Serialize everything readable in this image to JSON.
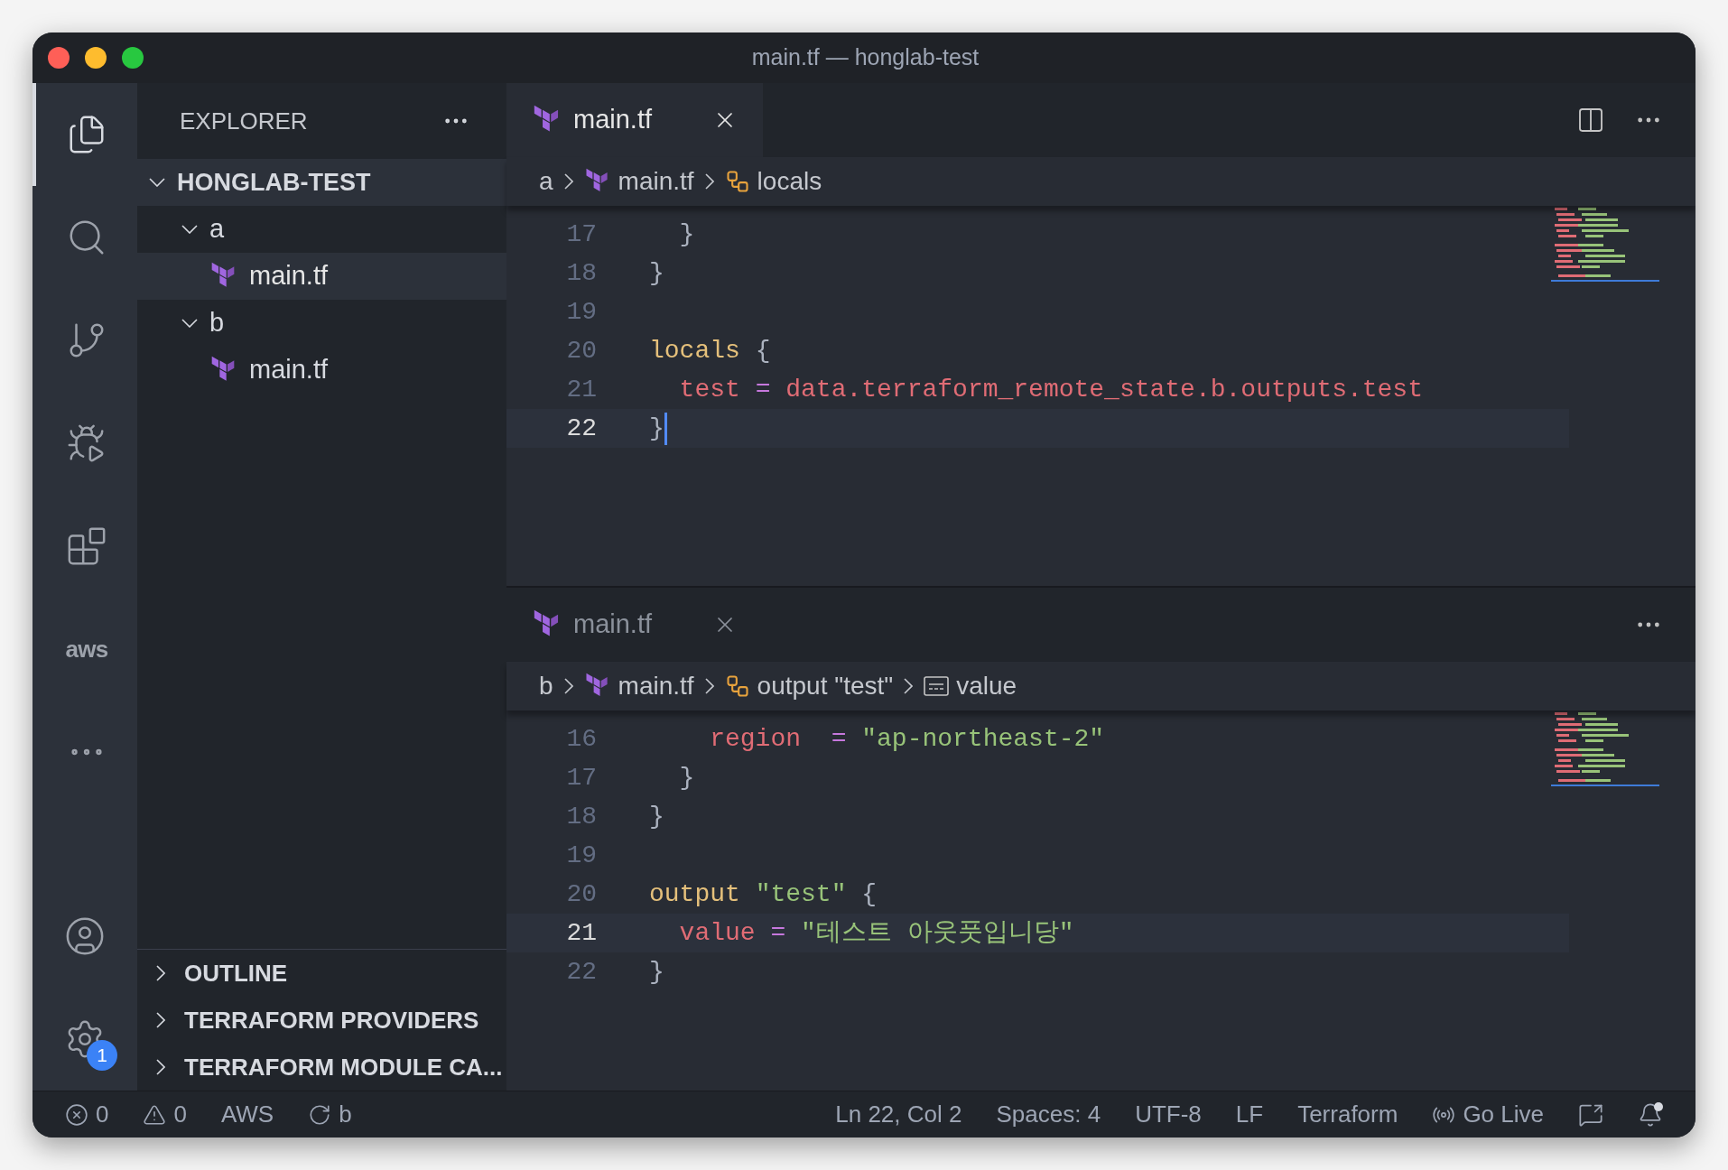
{
  "window": {
    "title": "main.tf — honglab-test"
  },
  "activity_bar": [
    {
      "kind": "files",
      "selected": true
    },
    {
      "kind": "search",
      "selected": false
    },
    {
      "kind": "source-control",
      "selected": false
    },
    {
      "kind": "run",
      "selected": false
    },
    {
      "kind": "extensions",
      "selected": false
    },
    {
      "kind": "aws",
      "label": "aws",
      "selected": false
    },
    {
      "kind": "more",
      "selected": false
    }
  ],
  "activity_bottom": [
    {
      "kind": "account"
    },
    {
      "kind": "settings",
      "badge": "1"
    }
  ],
  "sidebar": {
    "title": "EXPLORER",
    "root": {
      "label": "HONGLAB-TEST",
      "expanded": true,
      "children": [
        {
          "label": "a",
          "kind": "folder",
          "expanded": true,
          "children": [
            {
              "label": "main.tf",
              "kind": "file",
              "selected": true
            }
          ]
        },
        {
          "label": "b",
          "kind": "folder",
          "expanded": true,
          "children": [
            {
              "label": "main.tf",
              "kind": "file",
              "selected": false
            }
          ]
        }
      ]
    },
    "panels": [
      {
        "label": "OUTLINE",
        "expanded": false
      },
      {
        "label": "TERRAFORM PROVIDERS",
        "expanded": false
      },
      {
        "label": "TERRAFORM MODULE CA...",
        "expanded": false
      }
    ]
  },
  "editor_groups": [
    {
      "tab": {
        "label": "main.tf",
        "active": true
      },
      "split_action": true,
      "breadcrumb": [
        {
          "kind": "folder",
          "label": "a"
        },
        {
          "kind": "file",
          "label": "main.tf"
        },
        {
          "kind": "symbol",
          "label": "locals"
        }
      ],
      "lines": [
        {
          "number": "17",
          "current": false,
          "tokens": [
            {
              "kind": "plain",
              "text": "  }"
            }
          ]
        },
        {
          "number": "18",
          "current": false,
          "tokens": [
            {
              "kind": "plain",
              "text": "}"
            }
          ]
        },
        {
          "number": "19",
          "current": false
        },
        {
          "number": "20",
          "current": false,
          "tokens": [
            {
              "kind": "keyword",
              "text": "locals"
            },
            {
              "kind": "plain",
              "text": " {"
            }
          ]
        },
        {
          "number": "21",
          "current": false,
          "tokens": [
            {
              "kind": "attr",
              "text": "  test"
            },
            {
              "kind": "op",
              "text": " = "
            },
            {
              "kind": "attr",
              "text": "data.terraform_remote_state.b.outputs.test"
            }
          ]
        },
        {
          "number": "22",
          "current": true,
          "tokens": [
            {
              "kind": "plain",
              "text": "}"
            }
          ]
        }
      ]
    },
    {
      "tab": {
        "label": "main.tf",
        "active": false
      },
      "split_action": false,
      "breadcrumb": [
        {
          "kind": "folder",
          "label": "b"
        },
        {
          "kind": "file",
          "label": "main.tf"
        },
        {
          "kind": "symbol",
          "label": "output \"test\""
        },
        {
          "kind": "string",
          "label": "value"
        }
      ],
      "lines": [
        {
          "number": "16",
          "current": false,
          "tokens": [
            {
              "kind": "attr",
              "text": "    region"
            },
            {
              "kind": "op",
              "text": "  = "
            },
            {
              "kind": "string",
              "text": "\"ap-northeast-2\""
            }
          ]
        },
        {
          "number": "17",
          "current": false,
          "tokens": [
            {
              "kind": "plain",
              "text": "  }"
            }
          ]
        },
        {
          "number": "18",
          "current": false,
          "tokens": [
            {
              "kind": "plain",
              "text": "}"
            }
          ]
        },
        {
          "number": "19",
          "current": false
        },
        {
          "number": "20",
          "current": false,
          "tokens": [
            {
              "kind": "keyword",
              "text": "output"
            },
            {
              "kind": "string",
              "text": " \"test\""
            },
            {
              "kind": "plain",
              "text": " {"
            }
          ]
        },
        {
          "number": "21",
          "current": true,
          "tokens": [
            {
              "kind": "attr",
              "text": "  value"
            },
            {
              "kind": "op",
              "text": " = "
            },
            {
              "kind": "string",
              "text": "\"테스트 아웃풋입니당\""
            }
          ]
        },
        {
          "number": "22",
          "current": false,
          "tokens": [
            {
              "kind": "plain",
              "text": "}"
            }
          ]
        }
      ]
    }
  ],
  "status_bar": {
    "left": [
      {
        "kind": "errors",
        "text": "0"
      },
      {
        "kind": "warnings",
        "text": "0"
      },
      {
        "kind": "text",
        "text": "AWS"
      },
      {
        "kind": "sync",
        "text": "b"
      }
    ],
    "right": [
      {
        "kind": "text",
        "text": "Ln 22, Col 2"
      },
      {
        "kind": "text",
        "text": "Spaces: 4"
      },
      {
        "kind": "text",
        "text": "UTF-8"
      },
      {
        "kind": "text",
        "text": "LF"
      },
      {
        "kind": "text",
        "text": "Terraform"
      },
      {
        "kind": "live",
        "text": "Go Live"
      },
      {
        "kind": "feedback"
      },
      {
        "kind": "bell",
        "unread": true
      }
    ]
  }
}
